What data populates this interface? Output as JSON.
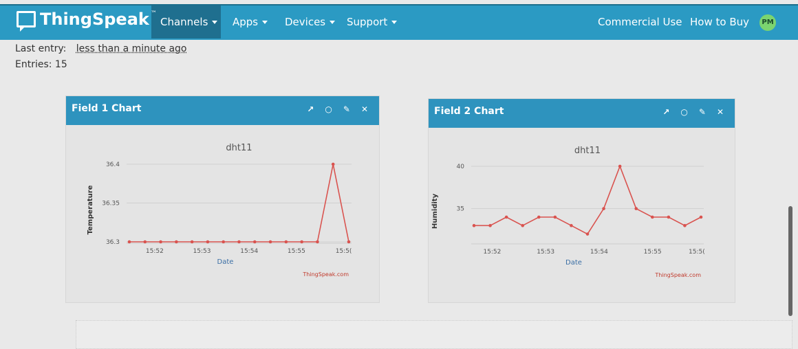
{
  "app": {
    "logo_text": "ThingSpeak",
    "logo_tm": "™",
    "brand_color": "#2b9ac3"
  },
  "nav": {
    "items": [
      {
        "label": "Channels"
      },
      {
        "label": "Apps"
      },
      {
        "label": "Devices"
      },
      {
        "label": "Support"
      }
    ],
    "right_items": [
      {
        "label": "Commercial Use"
      },
      {
        "label": "How to Buy"
      }
    ],
    "avatar": "PM"
  },
  "channel_info": {
    "last_entry_label": "Last entry:",
    "last_entry_value": "less than a minute ago",
    "entries_label": "Entries: 15"
  },
  "panels": [
    {
      "title": "Field 1 Chart",
      "icons": [
        "external-link-icon",
        "comment-icon",
        "pencil-icon",
        "close-icon"
      ]
    },
    {
      "title": "Field 2 Chart",
      "icons": [
        "external-link-icon",
        "comment-icon",
        "pencil-icon",
        "close-icon"
      ]
    }
  ],
  "chart_data": [
    {
      "type": "line",
      "title": "dht11",
      "xlabel": "Date",
      "ylabel": "Temperature",
      "credit": "ThingSpeak.com",
      "x_ticks": [
        "15:52",
        "15:53",
        "15:54",
        "15:55",
        "15:5("
      ],
      "y_ticks": [
        "36.3",
        "36.35",
        "36.4"
      ],
      "ylim": [
        36.3,
        36.4
      ],
      "grid": true,
      "series": [
        {
          "color": "#d9534f",
          "x": [
            0,
            1,
            2,
            3,
            4,
            5,
            6,
            7,
            8,
            9,
            10,
            11,
            12,
            13,
            14
          ],
          "values": [
            36.3,
            36.3,
            36.3,
            36.3,
            36.3,
            36.3,
            36.3,
            36.3,
            36.3,
            36.3,
            36.3,
            36.3,
            36.3,
            36.4,
            36.3
          ]
        }
      ]
    },
    {
      "type": "line",
      "title": "dht11",
      "xlabel": "Date",
      "ylabel": "Humidity",
      "credit": "ThingSpeak.com",
      "x_ticks": [
        "15:52",
        "15:53",
        "15:54",
        "15:55",
        "15:5("
      ],
      "y_ticks": [
        "35",
        "40"
      ],
      "ylim": [
        31,
        40
      ],
      "grid": true,
      "series": [
        {
          "color": "#d9534f",
          "x": [
            0,
            1,
            2,
            3,
            4,
            5,
            6,
            7,
            8,
            9,
            10,
            11,
            12,
            13,
            14
          ],
          "values": [
            33,
            33,
            34,
            33,
            34,
            34,
            33,
            32,
            35,
            40,
            35,
            34,
            34,
            33,
            34
          ]
        }
      ]
    }
  ]
}
